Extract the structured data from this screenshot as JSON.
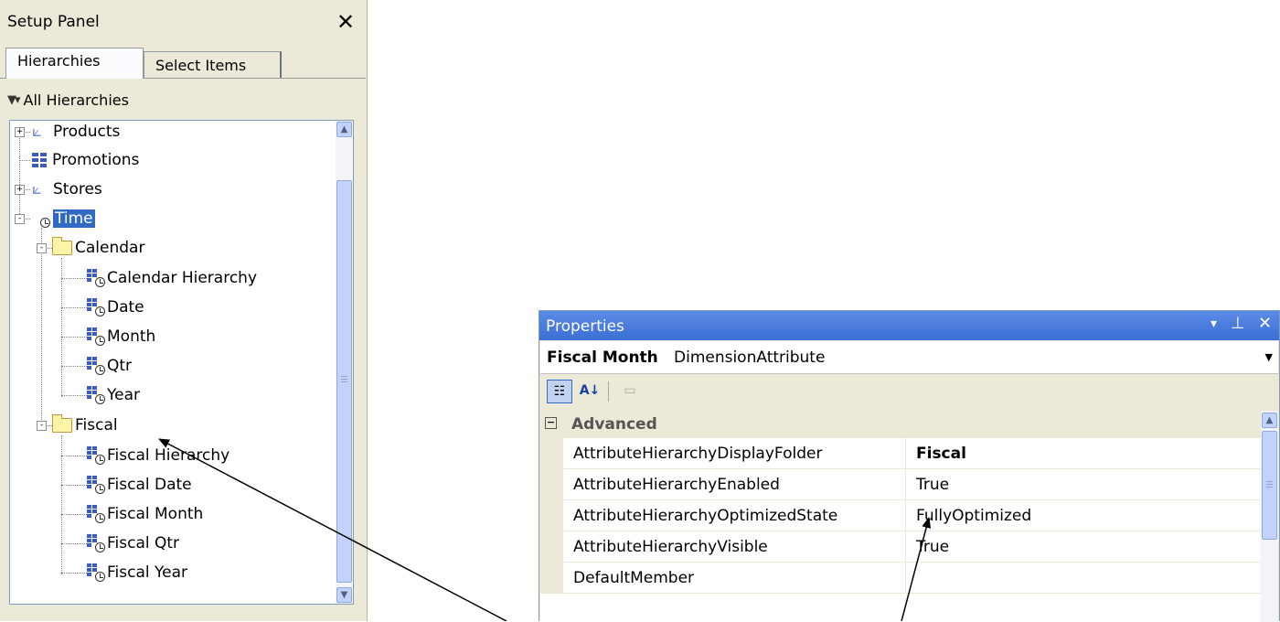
{
  "setup_panel": {
    "title": "Setup Panel",
    "close_glyph": "✕",
    "tabs": [
      {
        "label": "Hierarchies",
        "active": true
      },
      {
        "label": "Select Items",
        "active": false
      }
    ],
    "filter_label": "All Hierarchies",
    "tree": [
      {
        "label": "Products",
        "icon": "hierarchy-icon",
        "expander": "+"
      },
      {
        "label": "Promotions",
        "icon": "grid-icon"
      },
      {
        "label": "Stores",
        "icon": "hierarchy-icon",
        "expander": "+"
      },
      {
        "label": "Time",
        "icon": "time-dimension-icon",
        "expander": "-",
        "selected": true
      },
      {
        "label": "Calendar",
        "icon": "folder-icon",
        "expander": "-"
      },
      {
        "label": "Calendar Hierarchy",
        "icon": "time-hierarchy-icon"
      },
      {
        "label": "Date",
        "icon": "time-attribute-icon"
      },
      {
        "label": "Month",
        "icon": "time-attribute-icon"
      },
      {
        "label": "Qtr",
        "icon": "time-attribute-icon"
      },
      {
        "label": "Year",
        "icon": "time-attribute-icon"
      },
      {
        "label": "Fiscal",
        "icon": "folder-icon",
        "expander": "-"
      },
      {
        "label": "Fiscal Hierarchy",
        "icon": "time-hierarchy-icon"
      },
      {
        "label": "Fiscal Date",
        "icon": "time-attribute-icon"
      },
      {
        "label": "Fiscal Month",
        "icon": "time-attribute-icon"
      },
      {
        "label": "Fiscal Qtr",
        "icon": "time-attribute-icon"
      },
      {
        "label": "Fiscal Year",
        "icon": "time-attribute-icon"
      }
    ]
  },
  "properties_panel": {
    "title": "Properties",
    "object_name": "Fiscal Month",
    "object_type": "DimensionAttribute",
    "category": "Advanced",
    "category_toggle": "−",
    "rows": [
      {
        "name": "AttributeHierarchyDisplayFolder",
        "value": "Fiscal",
        "bold": true
      },
      {
        "name": "AttributeHierarchyEnabled",
        "value": "True"
      },
      {
        "name": "AttributeHierarchyOptimizedState",
        "value": "FullyOptimized"
      },
      {
        "name": "AttributeHierarchyVisible",
        "value": "True"
      },
      {
        "name": "DefaultMember",
        "value": ""
      }
    ]
  },
  "colors": {
    "title_bar": "#3b6fd4",
    "selection": "#316ac5",
    "panel_bg": "#ece9d8"
  }
}
